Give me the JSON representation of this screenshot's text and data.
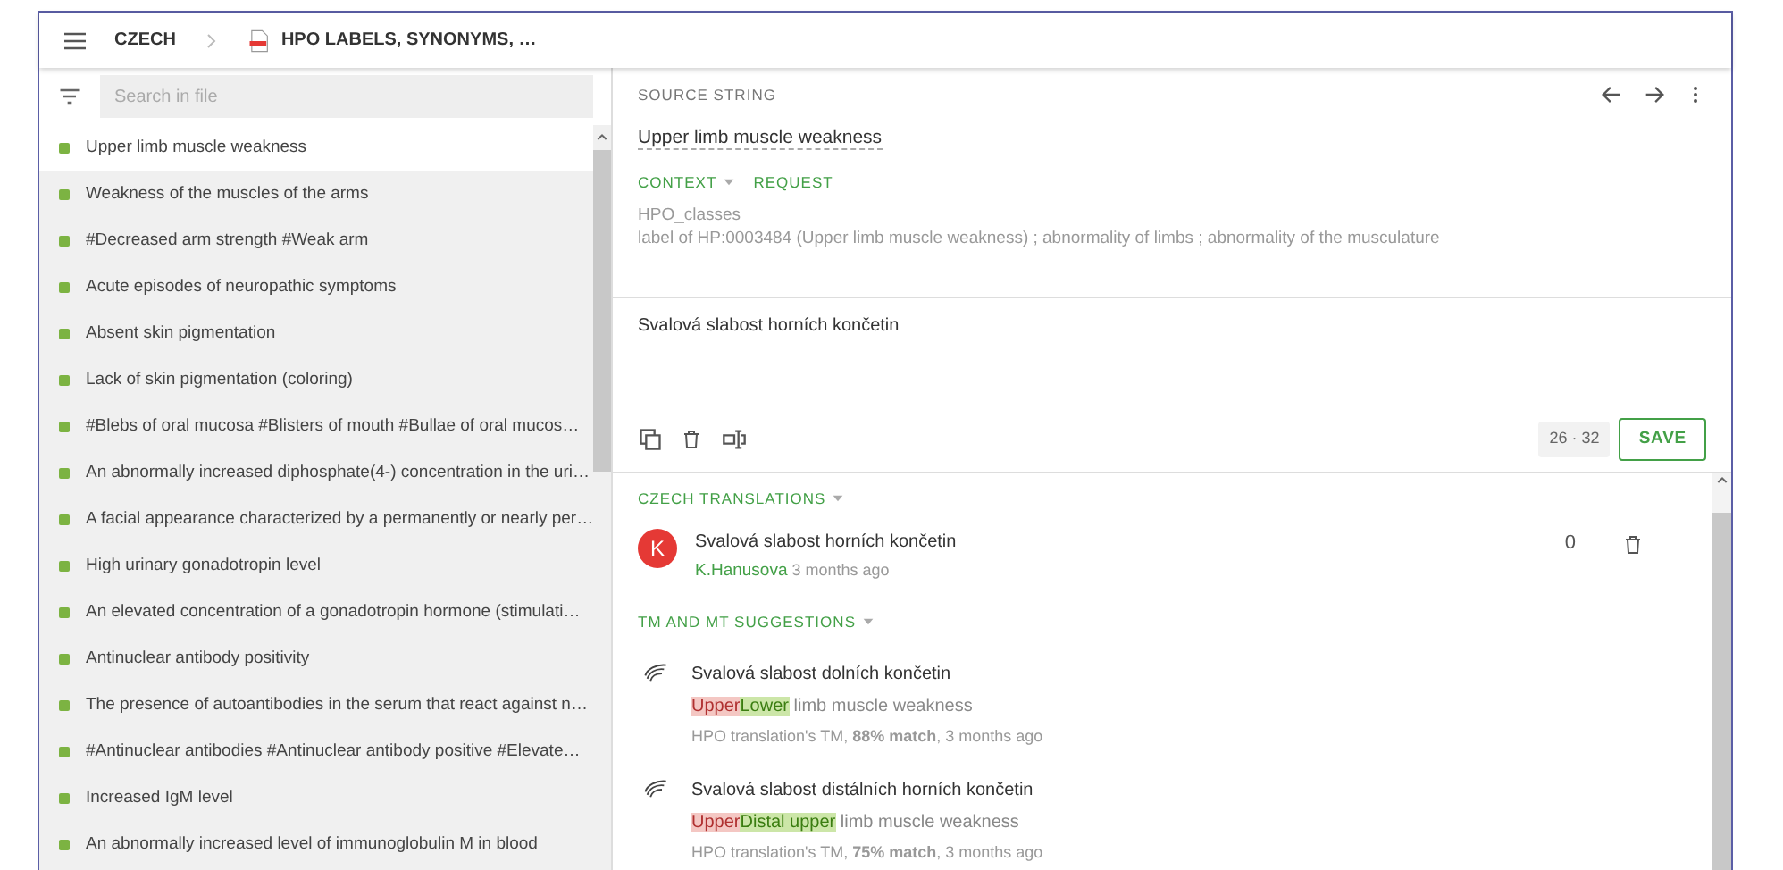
{
  "header": {
    "breadcrumbs": [
      "CZECH",
      "HPO LABELS, SYNONYMS, …"
    ]
  },
  "sidebar": {
    "search": {
      "placeholder": "Search in file"
    },
    "items": [
      {
        "text": "Upper limb muscle weakness",
        "selected": true
      },
      {
        "text": "Weakness of the muscles of the arms",
        "selected": false
      },
      {
        "text": "#Decreased arm strength #Weak arm",
        "selected": false
      },
      {
        "text": "Acute episodes of neuropathic symptoms",
        "selected": false
      },
      {
        "text": "Absent skin pigmentation",
        "selected": false
      },
      {
        "text": "Lack of skin pigmentation (coloring)",
        "selected": false
      },
      {
        "text": "#Blebs of oral mucosa #Blisters of mouth #Bullae of oral mucos…",
        "selected": false
      },
      {
        "text": "An abnormally increased diphosphate(4-) concentration in the uri…",
        "selected": false
      },
      {
        "text": "A facial appearance characterized by a permanently or nearly per…",
        "selected": false
      },
      {
        "text": "High urinary gonadotropin level",
        "selected": false
      },
      {
        "text": "An elevated concentration of a gonadotropin hormone (stimulati…",
        "selected": false
      },
      {
        "text": "Antinuclear antibody positivity",
        "selected": false
      },
      {
        "text": "The presence of autoantibodies in the serum that react against n…",
        "selected": false
      },
      {
        "text": "#Antinuclear antibodies #Antinuclear antibody positive #Elevate…",
        "selected": false
      },
      {
        "text": "Increased IgM level",
        "selected": false
      },
      {
        "text": "An abnormally increased level of immunoglobulin M in blood",
        "selected": false
      }
    ]
  },
  "source": {
    "label": "SOURCE STRING",
    "text": "Upper limb muscle weakness",
    "context_tabs": [
      {
        "label": "CONTEXT",
        "dropdown": true
      },
      {
        "label": "REQUEST",
        "dropdown": false
      }
    ],
    "context_lines": [
      "HPO_classes",
      "label of HP:0003484 (Upper limb muscle weakness) ; abnormality of limbs ; abnormality of the musculature"
    ]
  },
  "editor": {
    "value": "Svalová slabost horních končetin",
    "counter": "26 · 32",
    "save": "SAVE"
  },
  "translations": {
    "heading": "CZECH TRANSLATIONS",
    "items": [
      {
        "avatar": "K",
        "text": "Svalová slabost horních končetin",
        "author": "K.Hanusova",
        "time": "3 months ago",
        "votes": "0"
      }
    ]
  },
  "suggestions": {
    "heading": "TM AND MT SUGGESTIONS",
    "items": [
      {
        "text": "Svalová slabost dolních končetin",
        "diff": [
          {
            "kind": "removed",
            "text": "Upper"
          },
          {
            "kind": "added",
            "text": "Lower"
          },
          {
            "kind": "same",
            "text": " limb muscle weakness"
          }
        ],
        "meta": "HPO translation's TM, **88% match**, 3 months ago"
      },
      {
        "text": "Svalová slabost distálních horních končetin",
        "diff": [
          {
            "kind": "removed",
            "text": "Upper"
          },
          {
            "kind": "added",
            "text": "Distal upper"
          },
          {
            "kind": "same",
            "text": " limb muscle weakness"
          }
        ],
        "meta": "HPO translation's TM, **75% match**, 3 months ago"
      }
    ]
  }
}
